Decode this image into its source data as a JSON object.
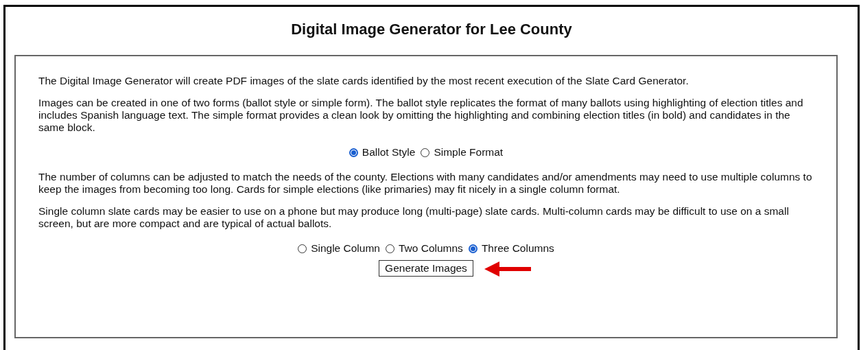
{
  "title": "Digital Image Generator for Lee County",
  "intro": [
    "The Digital Image Generator will create PDF images of the slate cards identified by the most recent execution of the Slate Card Generator.",
    "Images can be created in one of two forms (ballot style or simple form). The ballot style replicates the format of many ballots using highlighting of election titles and includes Spanish language text. The simple format provides a clean look by omitting the highlighting and combining election titles (in bold) and candidates in the same block."
  ],
  "format_options": [
    {
      "label": "Ballot Style",
      "selected": true
    },
    {
      "label": "Simple Format",
      "selected": false
    }
  ],
  "column_text": [
    "The number of columns can be adjusted to match the needs of the county. Elections with many candidates and/or amendments may need to use multiple columns to keep the images from becoming too long. Cards for simple elections (like primaries) may fit nicely in a single column format.",
    "Single column slate cards may be easier to use on a phone but may produce long (multi-page) slate cards. Multi-column cards may be difficult to use on a small screen, but are more compact and are typical of actual ballots."
  ],
  "column_options": [
    {
      "label": "Single Column",
      "selected": false
    },
    {
      "label": "Two Columns",
      "selected": false
    },
    {
      "label": "Three Columns",
      "selected": true
    }
  ],
  "button": "Generate Images"
}
